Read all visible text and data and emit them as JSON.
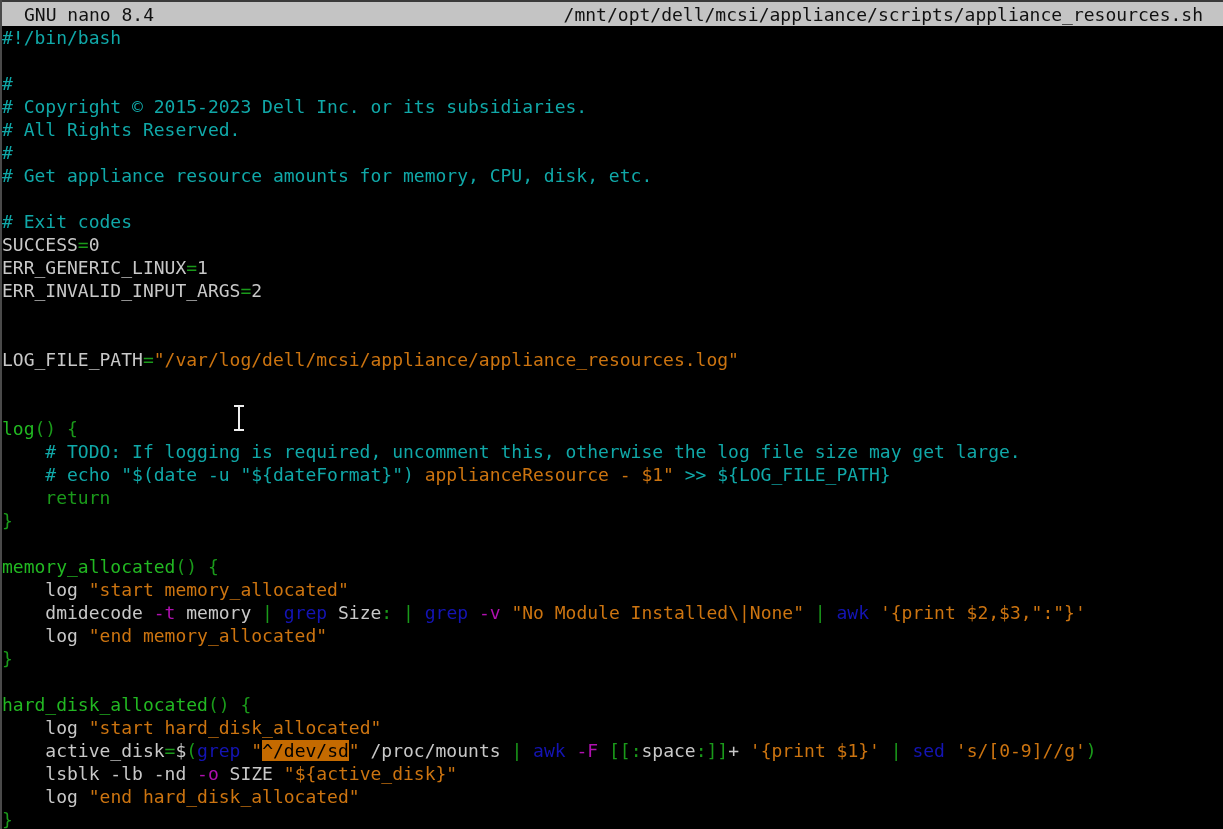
{
  "title_bar": {
    "app": "GNU nano 8.4",
    "file_path": "/mnt/opt/dell/mcsi/appliance/scripts/appliance_resources.sh"
  },
  "lines": [
    {
      "kind": "code",
      "segments": [
        {
          "text": "#!/bin/bash",
          "kind": "comment"
        }
      ]
    },
    {
      "kind": "blank"
    },
    {
      "kind": "code",
      "segments": [
        {
          "text": "#",
          "kind": "comment"
        }
      ]
    },
    {
      "kind": "code",
      "segments": [
        {
          "text": "# Copyright © 2015-2023 Dell Inc. or its subsidiaries.",
          "kind": "comment"
        }
      ]
    },
    {
      "kind": "code",
      "segments": [
        {
          "text": "# All Rights Reserved.",
          "kind": "comment"
        }
      ]
    },
    {
      "kind": "code",
      "segments": [
        {
          "text": "#",
          "kind": "comment"
        }
      ]
    },
    {
      "kind": "code",
      "segments": [
        {
          "text": "# Get appliance resource amounts for memory, CPU, disk, etc.",
          "kind": "comment"
        }
      ]
    },
    {
      "kind": "blank"
    },
    {
      "kind": "code",
      "segments": [
        {
          "text": "# Exit codes",
          "kind": "comment"
        }
      ]
    },
    {
      "kind": "code",
      "segments": [
        {
          "text": "SUCCESS",
          "kind": "plain"
        },
        {
          "text": "=",
          "kind": "operator"
        },
        {
          "text": "0",
          "kind": "plain"
        }
      ]
    },
    {
      "kind": "code",
      "segments": [
        {
          "text": "ERR_GENERIC_LINUX",
          "kind": "plain"
        },
        {
          "text": "=",
          "kind": "operator"
        },
        {
          "text": "1",
          "kind": "plain"
        }
      ]
    },
    {
      "kind": "code",
      "segments": [
        {
          "text": "ERR_INVALID_INPUT_ARGS",
          "kind": "plain"
        },
        {
          "text": "=",
          "kind": "operator"
        },
        {
          "text": "2",
          "kind": "plain"
        }
      ]
    },
    {
      "kind": "blank"
    },
    {
      "kind": "blank"
    },
    {
      "kind": "code",
      "segments": [
        {
          "text": "LOG_FILE_PATH",
          "kind": "plain"
        },
        {
          "text": "=",
          "kind": "operator"
        },
        {
          "text": "\"/var/log/dell/mcsi/appliance/appliance_resources.log\"",
          "kind": "string"
        }
      ]
    },
    {
      "kind": "blank"
    },
    {
      "kind": "blank"
    },
    {
      "kind": "code",
      "segments": [
        {
          "text": "log",
          "kind": "function"
        },
        {
          "text": "() {",
          "kind": "operator"
        }
      ]
    },
    {
      "kind": "code",
      "segments": [
        {
          "text": "    # TODO: If logging is required, uncomment this, otherwise the log file size may get large.",
          "kind": "comment"
        }
      ]
    },
    {
      "kind": "code",
      "segments": [
        {
          "text": "    # echo \"$(date -u \"${dateFormat}\") ",
          "kind": "comment"
        },
        {
          "text": "applianceResource - $1\"",
          "kind": "string"
        },
        {
          "text": " >> ${LOG_FILE_PATH}",
          "kind": "comment"
        }
      ]
    },
    {
      "kind": "code",
      "segments": [
        {
          "text": "    return",
          "kind": "operator"
        }
      ]
    },
    {
      "kind": "code",
      "segments": [
        {
          "text": "}",
          "kind": "operator"
        }
      ]
    },
    {
      "kind": "blank"
    },
    {
      "kind": "code",
      "segments": [
        {
          "text": "memory_allocated",
          "kind": "function"
        },
        {
          "text": "() {",
          "kind": "operator"
        }
      ]
    },
    {
      "kind": "code",
      "segments": [
        {
          "text": "    log ",
          "kind": "plain"
        },
        {
          "text": "\"start memory_allocated\"",
          "kind": "string"
        }
      ]
    },
    {
      "kind": "code",
      "segments": [
        {
          "text": "    dmidecode ",
          "kind": "plain"
        },
        {
          "text": "-t",
          "kind": "flag"
        },
        {
          "text": " memory ",
          "kind": "plain"
        },
        {
          "text": "| ",
          "kind": "operator"
        },
        {
          "text": "grep",
          "kind": "command"
        },
        {
          "text": " Size",
          "kind": "plain"
        },
        {
          "text": ": | ",
          "kind": "operator"
        },
        {
          "text": "grep ",
          "kind": "command"
        },
        {
          "text": "-v ",
          "kind": "flag"
        },
        {
          "text": "\"No Module Installed\\|None\" ",
          "kind": "string"
        },
        {
          "text": "| ",
          "kind": "operator"
        },
        {
          "text": "awk ",
          "kind": "command"
        },
        {
          "text": "'{print $2,$3,\":\"}'",
          "kind": "string"
        }
      ]
    },
    {
      "kind": "code",
      "segments": [
        {
          "text": "    log ",
          "kind": "plain"
        },
        {
          "text": "\"end memory_allocated\"",
          "kind": "string"
        }
      ]
    },
    {
      "kind": "code",
      "segments": [
        {
          "text": "}",
          "kind": "operator"
        }
      ]
    },
    {
      "kind": "blank"
    },
    {
      "kind": "code",
      "segments": [
        {
          "text": "hard_disk_allocated",
          "kind": "function"
        },
        {
          "text": "() {",
          "kind": "operator"
        }
      ]
    },
    {
      "kind": "code",
      "segments": [
        {
          "text": "    log ",
          "kind": "plain"
        },
        {
          "text": "\"start hard_disk_allocated\"",
          "kind": "string"
        }
      ]
    },
    {
      "kind": "code",
      "segments": [
        {
          "text": "    active_disk",
          "kind": "plain"
        },
        {
          "text": "=",
          "kind": "operator"
        },
        {
          "text": "$",
          "kind": "plain"
        },
        {
          "text": "(",
          "kind": "operator"
        },
        {
          "text": "grep ",
          "kind": "command"
        },
        {
          "text": "\"",
          "kind": "string"
        },
        {
          "text": "^/dev/sd",
          "kind": "match"
        },
        {
          "text": "\"",
          "kind": "string"
        },
        {
          "text": " /proc/mounts ",
          "kind": "plain"
        },
        {
          "text": "| ",
          "kind": "operator"
        },
        {
          "text": "awk ",
          "kind": "command"
        },
        {
          "text": "-F ",
          "kind": "flag"
        },
        {
          "text": "[[:",
          "kind": "operator"
        },
        {
          "text": "space",
          "kind": "plain"
        },
        {
          "text": ":]]",
          "kind": "operator"
        },
        {
          "text": "+ ",
          "kind": "plain"
        },
        {
          "text": "'{print $1}' ",
          "kind": "string"
        },
        {
          "text": "| ",
          "kind": "operator"
        },
        {
          "text": "sed ",
          "kind": "command"
        },
        {
          "text": "'s/[0-9]//g'",
          "kind": "string"
        },
        {
          "text": ")",
          "kind": "operator"
        }
      ]
    },
    {
      "kind": "code",
      "segments": [
        {
          "text": "    lsblk -lb -nd ",
          "kind": "plain"
        },
        {
          "text": "-o",
          "kind": "flag"
        },
        {
          "text": " SIZE ",
          "kind": "plain"
        },
        {
          "text": "\"${active_disk}\"",
          "kind": "string"
        }
      ]
    },
    {
      "kind": "code",
      "segments": [
        {
          "text": "    log ",
          "kind": "plain"
        },
        {
          "text": "\"end hard_disk_allocated\"",
          "kind": "string"
        }
      ]
    },
    {
      "kind": "code",
      "segments": [
        {
          "text": "}",
          "kind": "operator"
        }
      ]
    }
  ]
}
